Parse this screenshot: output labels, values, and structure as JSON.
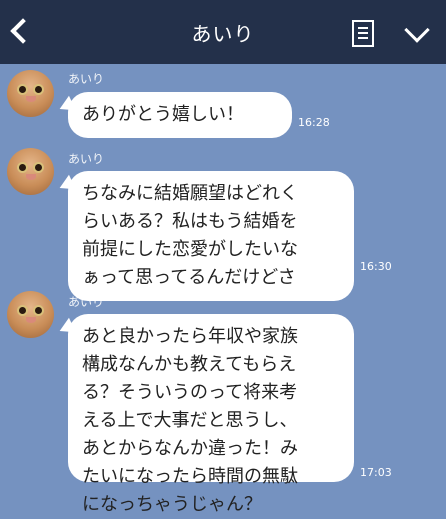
{
  "header": {
    "title": "あいり"
  },
  "messages": [
    {
      "sender": "あいり",
      "text": "ありがとう嬉しい！",
      "time": "16:28"
    },
    {
      "sender": "あいり",
      "text": "ちなみに結婚願望はどれく\nらいある？私はもう結婚を\n前提にした恋愛がしたいな\nぁって思ってるんだけどさ",
      "time": "16:30"
    },
    {
      "sender": "あいり",
      "text": "あと良かったら年収や家族\n構成なんかも教えてもらえ\nる？そういうのって将来考\nえる上で大事だと思うし、\nあとからなんか違った！み\nたいになったら時間の無駄\nになっちゃうじゃん？",
      "time": "17:03"
    }
  ],
  "icons": [
    "back-chevron-icon",
    "notes-icon",
    "chevron-down-icon"
  ],
  "colors": {
    "header": "#23304a",
    "background": "#7592c0",
    "bubble": "#ffffff"
  }
}
